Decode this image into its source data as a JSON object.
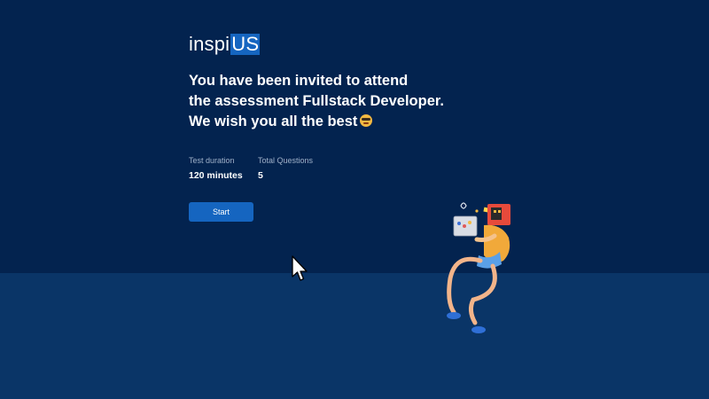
{
  "logo": {
    "text_main": "inspi",
    "text_accent": "US"
  },
  "headline": {
    "line1": "You have been invited to attend",
    "line2": "the assessment Fullstack Developer.",
    "line3": "We wish you all the best",
    "emoji_icon": "star-struck-face-icon"
  },
  "stats": {
    "duration_label": "Test duration",
    "duration_value": "120 minutes",
    "questions_label": "Total Questions",
    "questions_value": "5"
  },
  "actions": {
    "start_label": "Start"
  },
  "illustration": {
    "icon": "person-with-laptop-illustration"
  },
  "pointer": {
    "icon": "mouse-pointer-icon"
  },
  "colors": {
    "background": "#03234f",
    "lower_band": "#0a3567",
    "accent": "#1565c0",
    "label_text": "#9fb0c8",
    "text": "#ffffff"
  }
}
